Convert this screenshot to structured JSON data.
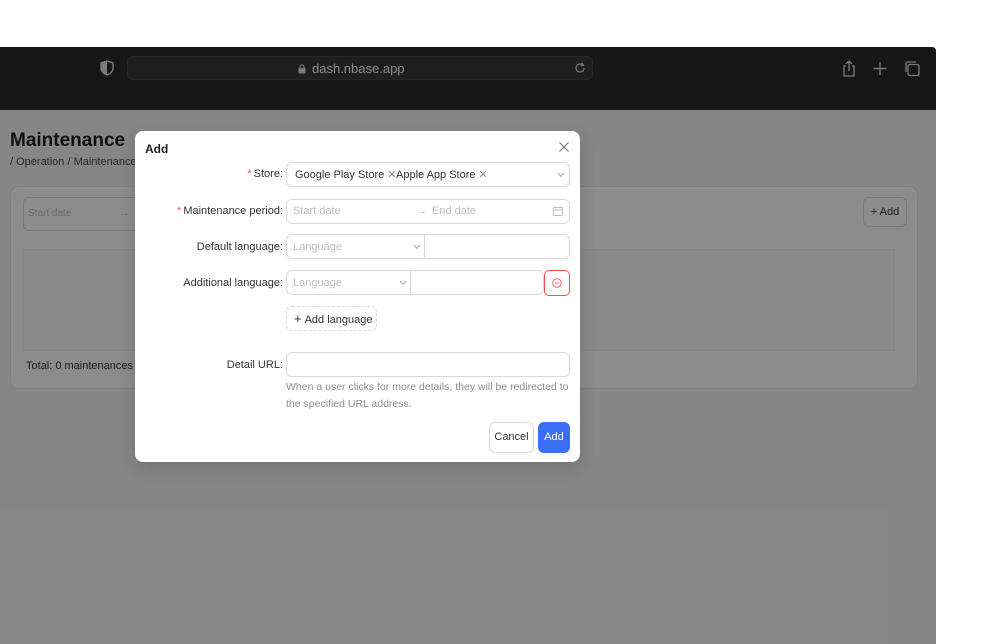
{
  "browser": {
    "url": "dash.nbase.app"
  },
  "page": {
    "title": "Maintenance",
    "breadcrumb": "/ Operation  /  Maintenance",
    "filter_start_placeholder": "Start date",
    "filter_arrow": "→",
    "add_button": "+ Add",
    "total": "Total: 0 maintenances"
  },
  "modal": {
    "title": "Add",
    "store": {
      "label": "Store:",
      "tags": [
        "Google Play Store",
        "Apple App Store"
      ]
    },
    "period": {
      "label": "Maintenance period:",
      "start_placeholder": "Start date",
      "arrow": "→",
      "end_placeholder": "End date"
    },
    "default_language": {
      "label": "Default language:",
      "placeholder": "Language"
    },
    "additional_language": {
      "label": "Additional language:",
      "placeholder": "Language"
    },
    "add_language_button": "Add language",
    "detail_url": {
      "label": "Detail URL:",
      "hint": "When a user clicks for more details, they will be redirected to the specified URL address."
    },
    "cancel_button": "Cancel",
    "add_button": "Add"
  },
  "colors": {
    "primary": "#3b6ff5",
    "danger": "#ff4d4f",
    "chrome": "#2b2b2b"
  }
}
